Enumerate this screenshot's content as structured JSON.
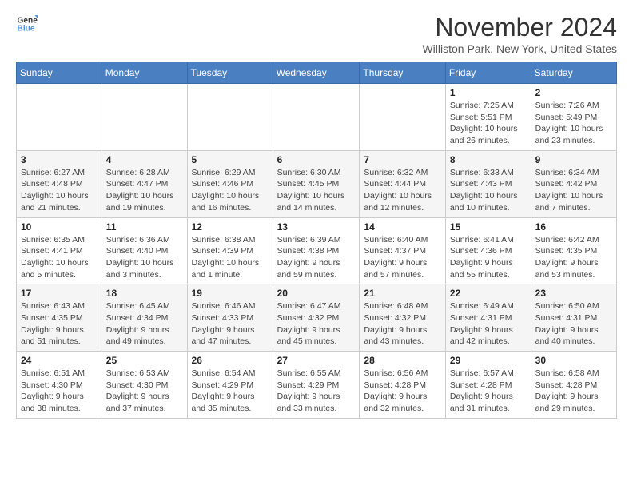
{
  "logo": {
    "line1": "General",
    "line2": "Blue"
  },
  "title": "November 2024",
  "subtitle": "Williston Park, New York, United States",
  "header": {
    "days": [
      "Sunday",
      "Monday",
      "Tuesday",
      "Wednesday",
      "Thursday",
      "Friday",
      "Saturday"
    ]
  },
  "weeks": [
    [
      {
        "day": "",
        "info": ""
      },
      {
        "day": "",
        "info": ""
      },
      {
        "day": "",
        "info": ""
      },
      {
        "day": "",
        "info": ""
      },
      {
        "day": "",
        "info": ""
      },
      {
        "day": "1",
        "info": "Sunrise: 7:25 AM\nSunset: 5:51 PM\nDaylight: 10 hours and 26 minutes."
      },
      {
        "day": "2",
        "info": "Sunrise: 7:26 AM\nSunset: 5:49 PM\nDaylight: 10 hours and 23 minutes."
      }
    ],
    [
      {
        "day": "3",
        "info": "Sunrise: 6:27 AM\nSunset: 4:48 PM\nDaylight: 10 hours and 21 minutes."
      },
      {
        "day": "4",
        "info": "Sunrise: 6:28 AM\nSunset: 4:47 PM\nDaylight: 10 hours and 19 minutes."
      },
      {
        "day": "5",
        "info": "Sunrise: 6:29 AM\nSunset: 4:46 PM\nDaylight: 10 hours and 16 minutes."
      },
      {
        "day": "6",
        "info": "Sunrise: 6:30 AM\nSunset: 4:45 PM\nDaylight: 10 hours and 14 minutes."
      },
      {
        "day": "7",
        "info": "Sunrise: 6:32 AM\nSunset: 4:44 PM\nDaylight: 10 hours and 12 minutes."
      },
      {
        "day": "8",
        "info": "Sunrise: 6:33 AM\nSunset: 4:43 PM\nDaylight: 10 hours and 10 minutes."
      },
      {
        "day": "9",
        "info": "Sunrise: 6:34 AM\nSunset: 4:42 PM\nDaylight: 10 hours and 7 minutes."
      }
    ],
    [
      {
        "day": "10",
        "info": "Sunrise: 6:35 AM\nSunset: 4:41 PM\nDaylight: 10 hours and 5 minutes."
      },
      {
        "day": "11",
        "info": "Sunrise: 6:36 AM\nSunset: 4:40 PM\nDaylight: 10 hours and 3 minutes."
      },
      {
        "day": "12",
        "info": "Sunrise: 6:38 AM\nSunset: 4:39 PM\nDaylight: 10 hours and 1 minute."
      },
      {
        "day": "13",
        "info": "Sunrise: 6:39 AM\nSunset: 4:38 PM\nDaylight: 9 hours and 59 minutes."
      },
      {
        "day": "14",
        "info": "Sunrise: 6:40 AM\nSunset: 4:37 PM\nDaylight: 9 hours and 57 minutes."
      },
      {
        "day": "15",
        "info": "Sunrise: 6:41 AM\nSunset: 4:36 PM\nDaylight: 9 hours and 55 minutes."
      },
      {
        "day": "16",
        "info": "Sunrise: 6:42 AM\nSunset: 4:35 PM\nDaylight: 9 hours and 53 minutes."
      }
    ],
    [
      {
        "day": "17",
        "info": "Sunrise: 6:43 AM\nSunset: 4:35 PM\nDaylight: 9 hours and 51 minutes."
      },
      {
        "day": "18",
        "info": "Sunrise: 6:45 AM\nSunset: 4:34 PM\nDaylight: 9 hours and 49 minutes."
      },
      {
        "day": "19",
        "info": "Sunrise: 6:46 AM\nSunset: 4:33 PM\nDaylight: 9 hours and 47 minutes."
      },
      {
        "day": "20",
        "info": "Sunrise: 6:47 AM\nSunset: 4:32 PM\nDaylight: 9 hours and 45 minutes."
      },
      {
        "day": "21",
        "info": "Sunrise: 6:48 AM\nSunset: 4:32 PM\nDaylight: 9 hours and 43 minutes."
      },
      {
        "day": "22",
        "info": "Sunrise: 6:49 AM\nSunset: 4:31 PM\nDaylight: 9 hours and 42 minutes."
      },
      {
        "day": "23",
        "info": "Sunrise: 6:50 AM\nSunset: 4:31 PM\nDaylight: 9 hours and 40 minutes."
      }
    ],
    [
      {
        "day": "24",
        "info": "Sunrise: 6:51 AM\nSunset: 4:30 PM\nDaylight: 9 hours and 38 minutes."
      },
      {
        "day": "25",
        "info": "Sunrise: 6:53 AM\nSunset: 4:30 PM\nDaylight: 9 hours and 37 minutes."
      },
      {
        "day": "26",
        "info": "Sunrise: 6:54 AM\nSunset: 4:29 PM\nDaylight: 9 hours and 35 minutes."
      },
      {
        "day": "27",
        "info": "Sunrise: 6:55 AM\nSunset: 4:29 PM\nDaylight: 9 hours and 33 minutes."
      },
      {
        "day": "28",
        "info": "Sunrise: 6:56 AM\nSunset: 4:28 PM\nDaylight: 9 hours and 32 minutes."
      },
      {
        "day": "29",
        "info": "Sunrise: 6:57 AM\nSunset: 4:28 PM\nDaylight: 9 hours and 31 minutes."
      },
      {
        "day": "30",
        "info": "Sunrise: 6:58 AM\nSunset: 4:28 PM\nDaylight: 9 hours and 29 minutes."
      }
    ]
  ]
}
